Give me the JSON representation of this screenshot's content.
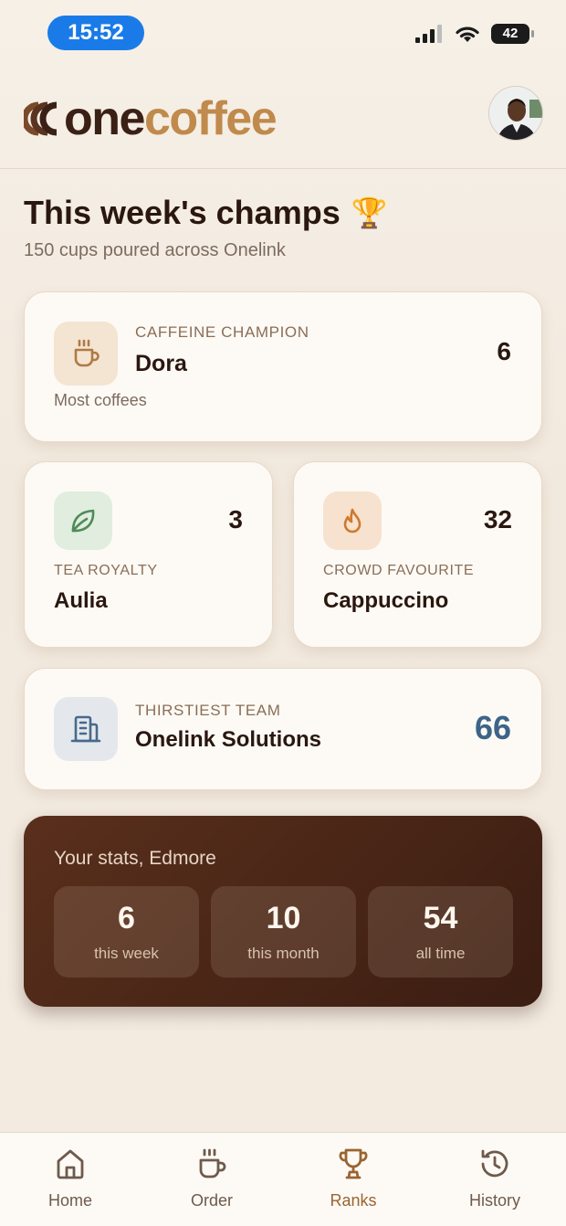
{
  "status_bar": {
    "time": "15:52",
    "battery": "42"
  },
  "header": {
    "logo_one": "one",
    "logo_coffee": "coffee"
  },
  "page": {
    "title": "This week's champs",
    "title_emoji": "🏆",
    "subtitle": "150 cups poured across Onelink"
  },
  "champion": {
    "label": "CAFFEINE CHAMPION",
    "name": "Dora",
    "caption": "Most coffees",
    "count": "6",
    "icon": "coffee-cup-icon"
  },
  "tea": {
    "label": "TEA ROYALTY",
    "name": "Aulia",
    "count": "3",
    "icon": "leaf-icon"
  },
  "favourite": {
    "label": "CROWD FAVOURITE",
    "name": "Cappuccino",
    "count": "32",
    "icon": "flame-icon"
  },
  "team": {
    "label": "THIRSTIEST TEAM",
    "name": "Onelink Solutions",
    "count": "66",
    "icon": "building-icon"
  },
  "your_stats": {
    "title": "Your stats, Edmore",
    "items": [
      {
        "value": "6",
        "label": "this week"
      },
      {
        "value": "10",
        "label": "this month"
      },
      {
        "value": "54",
        "label": "all time"
      }
    ]
  },
  "nav": [
    {
      "label": "Home",
      "icon": "home-icon"
    },
    {
      "label": "Order",
      "icon": "coffee-cup-icon"
    },
    {
      "label": "Ranks",
      "icon": "trophy-icon",
      "active": true
    },
    {
      "label": "History",
      "icon": "history-icon"
    }
  ],
  "colors": {
    "brand_dark": "#3b2016",
    "brand_accent": "#c08a4c",
    "team_count": "#3d6488",
    "active_nav": "#9a6430",
    "stats_bg": "#4a2617"
  }
}
